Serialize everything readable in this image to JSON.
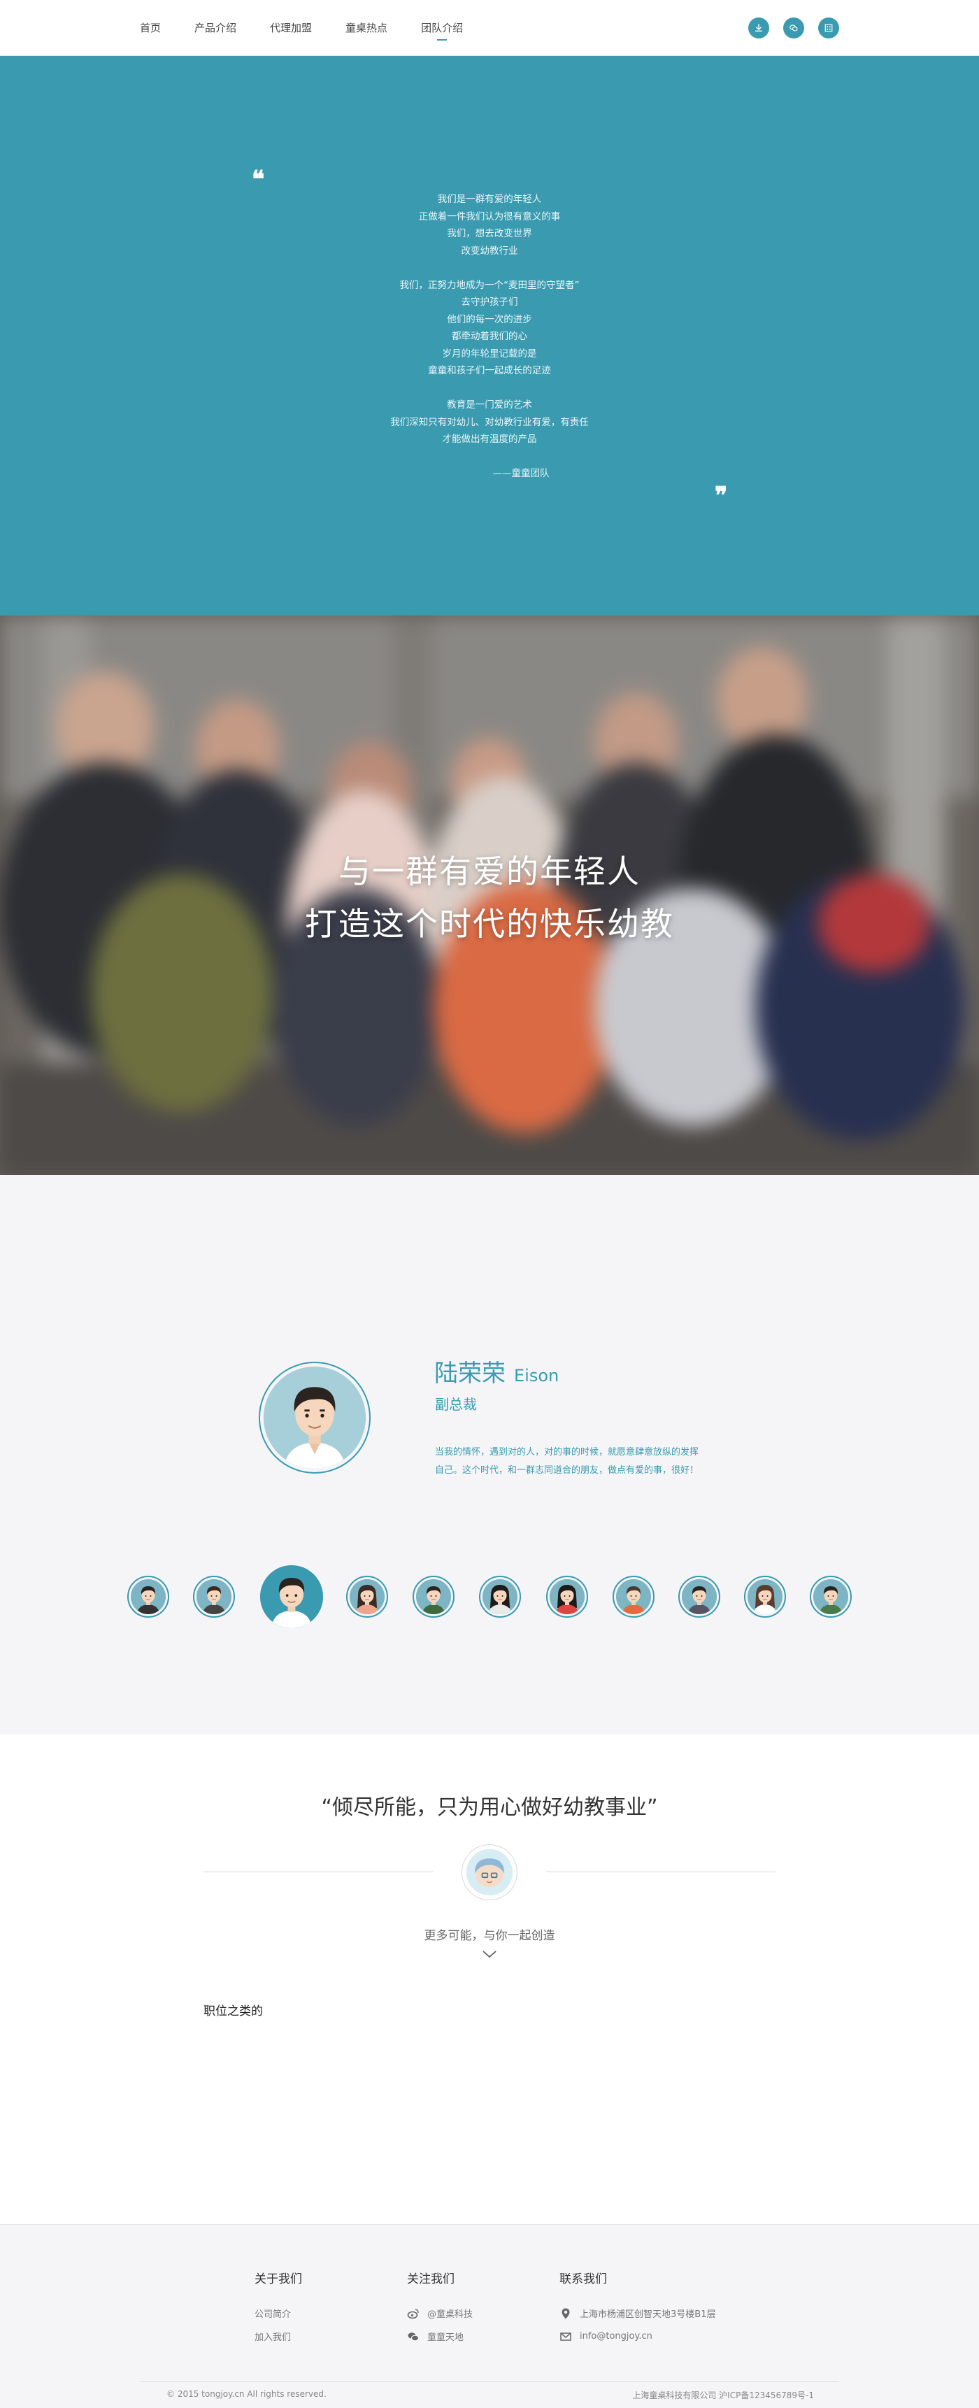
{
  "nav": {
    "items": [
      "首页",
      "产品介绍",
      "代理加盟",
      "童桌热点",
      "团队介绍"
    ],
    "active_index": 4,
    "icons": [
      "download-icon",
      "wechat-icon",
      "qrcode-icon"
    ]
  },
  "quote": {
    "lines": [
      "我们是一群有爱的年轻人",
      "正做着一件我们认为很有意义的事",
      "我们，想去改变世界",
      "改变幼教行业",
      "",
      "我们，正努力地成为一个“麦田里的守望者”",
      "去守护孩子们",
      "他们的每一次的进步",
      "都牵动着我们的心",
      "岁月的年轮里记载的是",
      "童童和孩子们一起成长的足迹",
      "",
      "教育是一门爱的艺术",
      "我们深知只有对幼儿、对幼教行业有爱，有责任",
      "才能做出有温度的产品",
      "",
      "——童童团队"
    ]
  },
  "banner": {
    "slogan_line1": "与一群有爱的年轻人",
    "slogan_line2": "打造这个时代的快乐幼教"
  },
  "team": {
    "member": {
      "name": "陆荣荣",
      "english_name": "Eison",
      "role": "副总裁",
      "desc_line1": "当我的情怀，遇到对的人，对的事的时候，就愿意肆意放纵的发挥",
      "desc_line2": "自己。这个时代，和一群志同道合的朋友，做点有爱的事，很好！"
    },
    "selected_index": 2,
    "member_count": 11
  },
  "motto": {
    "title": "“倾尽所能，只为用心做好幼教事业”",
    "subtitle": "更多可能，与你一起创造",
    "jobs_heading": "职位之类的"
  },
  "footer": {
    "about": {
      "title": "关于我们",
      "links": [
        "公司简介",
        "加入我们"
      ]
    },
    "follow": {
      "title": "关注我们",
      "weibo": "@童桌科技",
      "wechat": "童童天地"
    },
    "contact": {
      "title": "联系我们",
      "address": "上海市杨浦区创智天地3号楼B1层",
      "email": "info@tongjoy.cn"
    },
    "copyright": "© 2015 tongjoy.cn All rights reserved.",
    "icp": "上海童桌科技有限公司  沪ICP备123456789号-1"
  },
  "colors": {
    "accent": "#3a9bb0",
    "background": "#f5f5f7"
  }
}
